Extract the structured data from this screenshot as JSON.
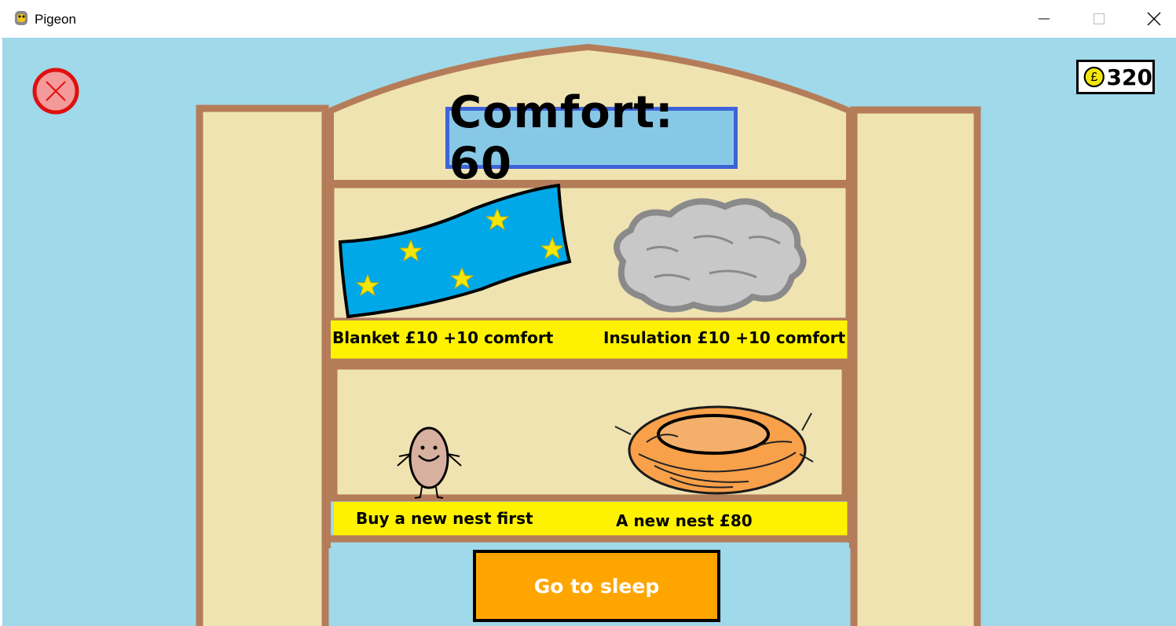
{
  "window": {
    "title": "Pigeon",
    "controls": [
      "minimize-icon",
      "maximize-icon",
      "close-icon"
    ]
  },
  "hud": {
    "money_icon": "pound-coin-icon",
    "money": "320",
    "close_icon": "close-circle-icon"
  },
  "shop": {
    "comfort_label": "Comfort: 60",
    "items": [
      {
        "label": "Blanket £10 +10 comfort",
        "icon": "blanket-icon"
      },
      {
        "label": "Insulation £10 +10 comfort",
        "icon": "insulation-cloud-icon"
      },
      {
        "label": "Buy a new nest first",
        "icon": "egg-character-icon"
      },
      {
        "label": "A new nest £80",
        "icon": "nest-icon"
      }
    ]
  },
  "actions": {
    "sleep_label": "Go to sleep"
  },
  "colors": {
    "sky": "#9fd9ea",
    "wood": "#b57c5a",
    "panel": "#efe3b2",
    "label_bar": "#fff200",
    "comfort_bg": "#88c8e7",
    "comfort_border": "#3e63d8",
    "sleep_button": "#ffa500",
    "close_button": "#f39a9a"
  }
}
